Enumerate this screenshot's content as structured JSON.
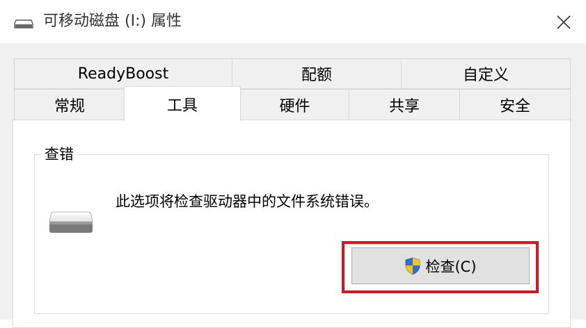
{
  "window": {
    "title": "可移动磁盘 (I:) 属性"
  },
  "tabs": {
    "row1": [
      {
        "label": "ReadyBoost"
      },
      {
        "label": "配额"
      },
      {
        "label": "自定义"
      }
    ],
    "row2": [
      {
        "label": "常规"
      },
      {
        "label": "工具",
        "active": true
      },
      {
        "label": "硬件"
      },
      {
        "label": "共享"
      },
      {
        "label": "安全"
      }
    ]
  },
  "error_check": {
    "group_label": "查错",
    "description": "此选项将检查驱动器中的文件系统错误。",
    "button_label": "检查(C)"
  },
  "icons": {
    "title": "drive-icon",
    "close": "close-icon",
    "drive": "drive-icon",
    "shield": "uac-shield-icon"
  },
  "colors": {
    "highlight": "#d9141b",
    "shield_blue": "#2e6fd2",
    "shield_yellow": "#f5c21b"
  }
}
